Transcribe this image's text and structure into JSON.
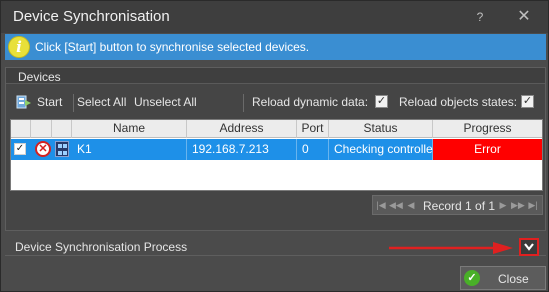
{
  "window": {
    "title": "Device Synchronisation",
    "help_glyph": "?",
    "close_glyph": "✕"
  },
  "info": {
    "text": "Click [Start] button to synchronise selected devices.",
    "icon": "info-icon"
  },
  "devices": {
    "group_title": "Devices",
    "toolbar": {
      "start_label": "Start",
      "select_all_label": "Select All",
      "unselect_all_label": "Unselect All",
      "reload_dynamic_label": "Reload dynamic data:",
      "reload_dynamic_checked": true,
      "reload_objects_label": "Reload objects states:",
      "reload_objects_checked": true
    },
    "columns": [
      "Name",
      "Address",
      "Port",
      "Status",
      "Progress"
    ],
    "rows": [
      {
        "checked": true,
        "name": "K1",
        "address": "192.168.7.213",
        "port": "0",
        "status": "Checking controller",
        "progress": "Error"
      }
    ],
    "pager": {
      "text": "Record 1 of 1"
    }
  },
  "process": {
    "title": "Device Synchronisation Process"
  },
  "footer": {
    "close_label": "Close"
  },
  "colors": {
    "accent": "#1e90e8",
    "info_bar": "#3a8ed2",
    "error": "#ff0000",
    "highlight": "#e02020"
  }
}
